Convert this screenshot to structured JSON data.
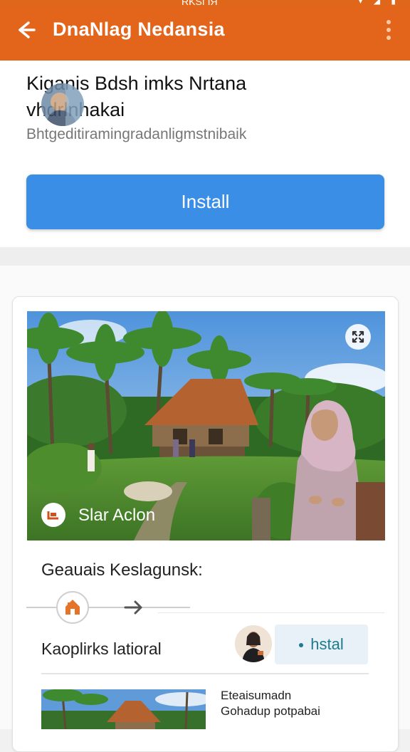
{
  "status_bar": {
    "time": "RKSI ІЯ",
    "icons_text": "▾ ◢ ▮"
  },
  "app_bar": {
    "title": "DnaNlag Nedansia",
    "back_icon": "arrow-left-icon",
    "more_icon": "more-vert-icon",
    "color": "#e3651c"
  },
  "hero": {
    "headline_line1": "Kiganis Bdsh imks Nrtana",
    "headline_line2": "vhdrlnhakai",
    "subtitle": "Bhtgeditiramingradanligmstnibaik",
    "install_label": "Install",
    "install_color": "#3a8ee6"
  },
  "feature_card": {
    "media_action_label": "Slar Aclon",
    "expand_icon": "expand-icon",
    "play_icon": "play-icon",
    "section_title": "Geauais Keslagunsk:",
    "step_icon": "house-icon",
    "next_icon": "arrow-right-icon",
    "item_label": "Kaoplirks latioral",
    "item_install_label": "hstal",
    "next_item_line1": "Eteaisumadn",
    "next_item_line2": "Gohadup potpabai"
  }
}
